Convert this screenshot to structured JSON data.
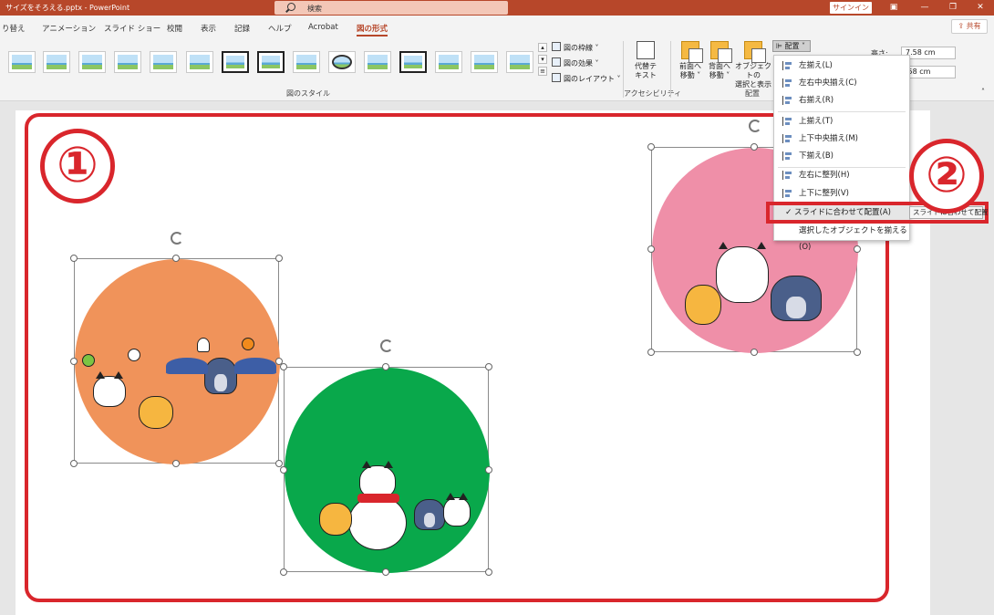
{
  "window": {
    "title": "サイズをそろえる.pptx  -  PowerPoint",
    "search_placeholder": "検索",
    "signin": "サインイン",
    "share": "共有"
  },
  "tabs": [
    {
      "label": "り替え"
    },
    {
      "label": "アニメーション"
    },
    {
      "label": "スライド ショー"
    },
    {
      "label": "校閲"
    },
    {
      "label": "表示"
    },
    {
      "label": "記録"
    },
    {
      "label": "ヘルプ"
    },
    {
      "label": "Acrobat"
    },
    {
      "label": "図の形式",
      "active": true
    }
  ],
  "ribbon": {
    "picture_border": "図の枠線",
    "picture_effects": "図の効果",
    "picture_layout": "図のレイアウト",
    "group_picture_styles": "図のスタイル",
    "alt_text_line1": "代替テ",
    "alt_text_line2": "キスト",
    "group_accessibility": "アクセシビリティ",
    "bring_forward_line1": "前面へ",
    "bring_forward_line2": "移動",
    "send_backward_line1": "背面へ",
    "send_backward_line2": "移動",
    "selection_pane_line1": "オブジェクトの",
    "selection_pane_line2": "選択と表示",
    "group_arrange": "配置",
    "align_button": "配置",
    "height_label": "高さ:",
    "height_value": "7.58 cm",
    "width_value": "7.58 cm",
    "width_value_visible": ".58 cm"
  },
  "align_menu": {
    "items": [
      {
        "label": "左揃え(L)",
        "icon": "align-left-icon"
      },
      {
        "label": "左右中央揃え(C)",
        "icon": "align-center-icon"
      },
      {
        "label": "右揃え(R)",
        "icon": "align-right-icon"
      },
      {
        "label": "上揃え(T)",
        "icon": "align-top-icon"
      },
      {
        "label": "上下中央揃え(M)",
        "icon": "align-middle-icon"
      },
      {
        "label": "下揃え(B)",
        "icon": "align-bottom-icon"
      },
      {
        "label": "左右に整列(H)",
        "icon": "distribute-horizontal-icon"
      },
      {
        "label": "上下に整列(V)",
        "icon": "distribute-vertical-icon"
      },
      {
        "label": "スライドに合わせて配置(A)",
        "checked": true
      },
      {
        "label": "選択したオブジェクトを揃える(O)"
      }
    ],
    "tooltip": "スライドに合わせて配置"
  },
  "annotations": {
    "marker_1": "①",
    "marker_2": "②",
    "accent_color": "#d9262c"
  },
  "slide_images": [
    {
      "name": "halloween",
      "color": "#f0935a"
    },
    {
      "name": "winter",
      "color": "#09a84b"
    },
    {
      "name": "group",
      "color": "#ef8fa8"
    }
  ],
  "colors": {
    "titlebar": "#b7472a",
    "ribbon": "#f3f3f3",
    "highlight": "#d9262c"
  }
}
